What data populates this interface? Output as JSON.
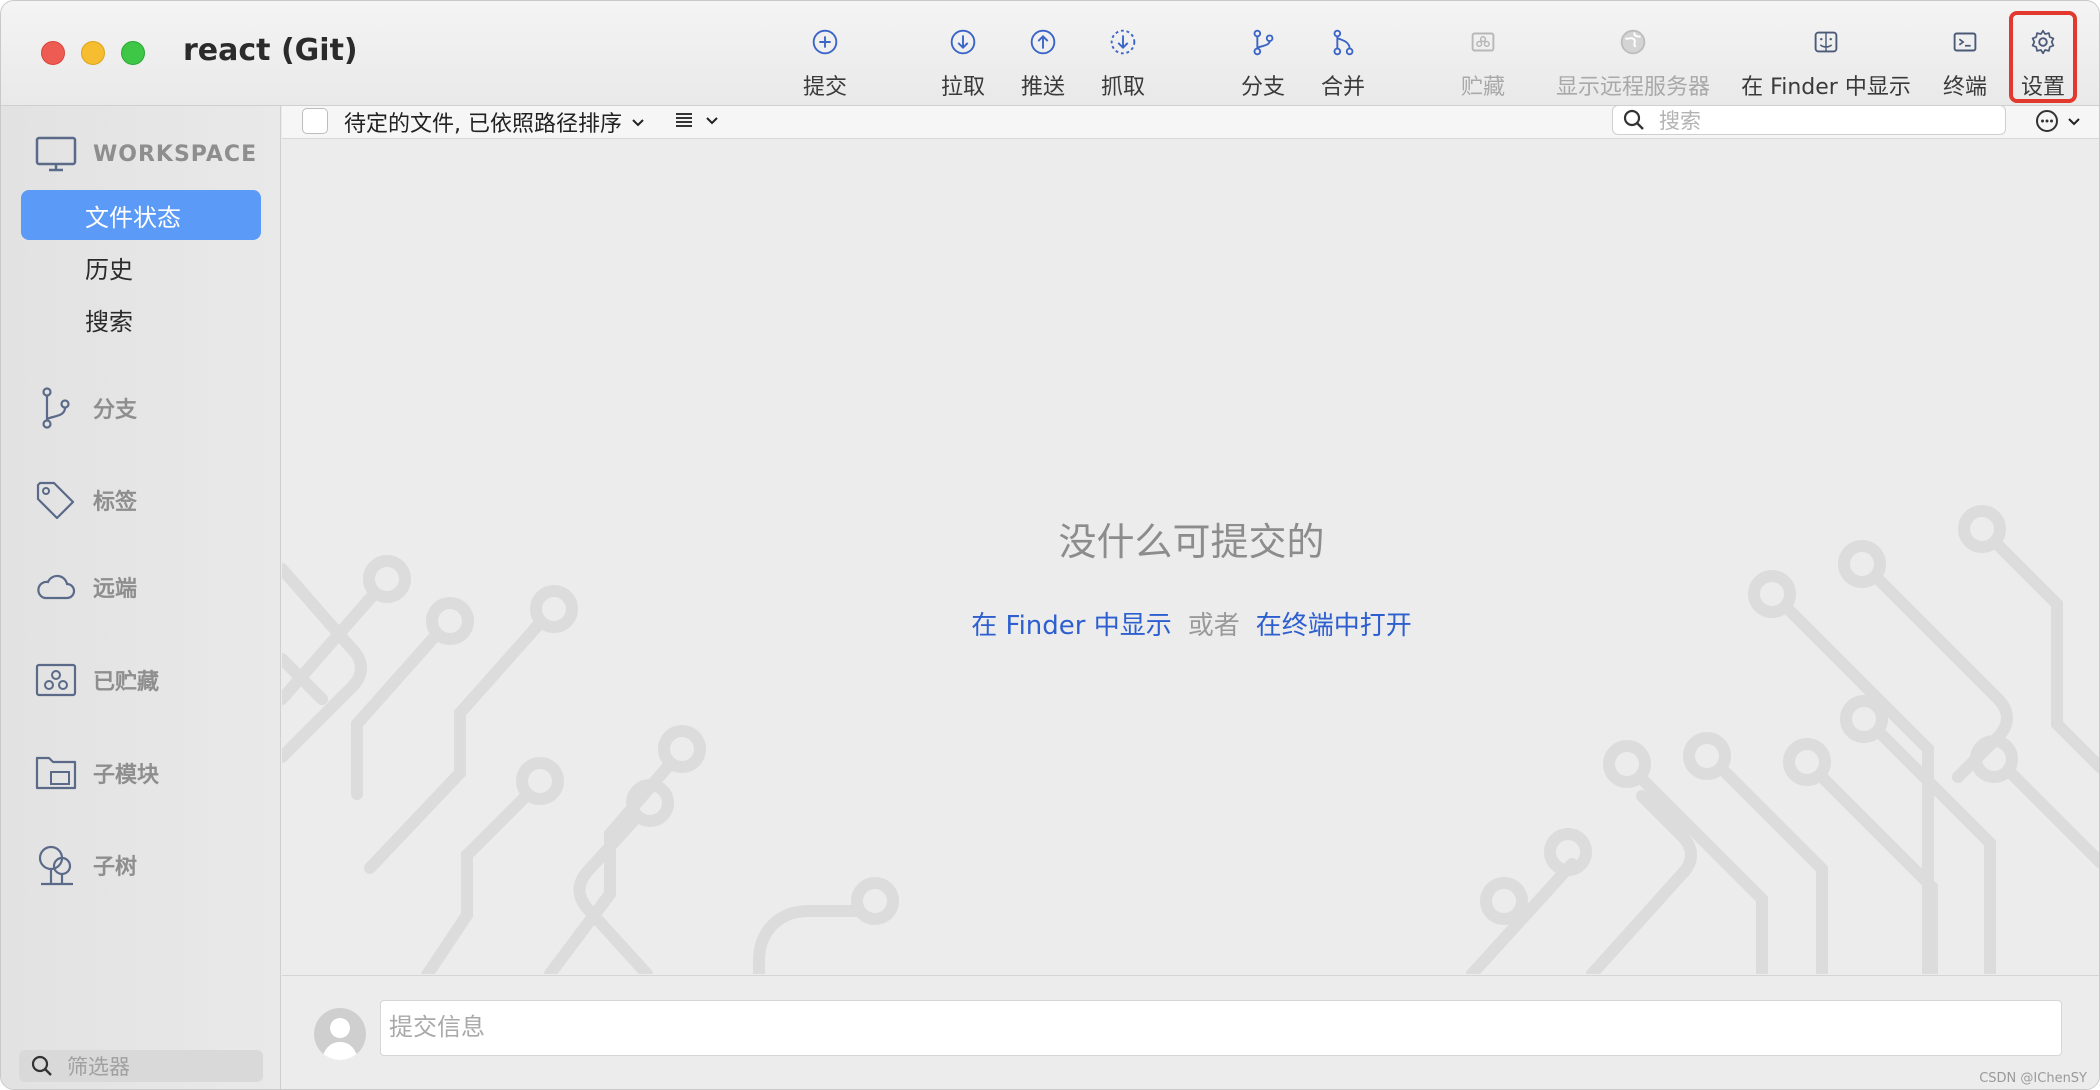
{
  "window": {
    "title": "react (Git)"
  },
  "toolbar": {
    "buttons": [
      {
        "label": "提交",
        "icon": "plus-circle-icon",
        "enabled": true
      },
      {
        "label": "拉取",
        "icon": "arrow-down-circle-icon",
        "enabled": true
      },
      {
        "label": "推送",
        "icon": "arrow-up-circle-icon",
        "enabled": true
      },
      {
        "label": "抓取",
        "icon": "fetch-dashed-circle-icon",
        "enabled": true
      },
      {
        "label": "分支",
        "icon": "branch-icon",
        "enabled": true
      },
      {
        "label": "合并",
        "icon": "merge-icon",
        "enabled": true
      },
      {
        "label": "贮藏",
        "icon": "stash-icon",
        "enabled": false
      },
      {
        "label": "显示远程服务器",
        "icon": "globe-icon",
        "enabled": false
      },
      {
        "label": "在 Finder 中显示",
        "icon": "finder-icon",
        "enabled": true
      },
      {
        "label": "终端",
        "icon": "terminal-icon",
        "enabled": true
      },
      {
        "label": "设置",
        "icon": "gear-icon",
        "enabled": true,
        "highlighted": true
      }
    ]
  },
  "sidebar": {
    "workspace_label": "WORKSPACE",
    "workspace_items": [
      {
        "label": "文件状态",
        "active": true
      },
      {
        "label": "历史",
        "active": false
      },
      {
        "label": "搜索",
        "active": false
      }
    ],
    "sections": [
      {
        "label": "分支",
        "icon": "branch-icon"
      },
      {
        "label": "标签",
        "icon": "tag-icon"
      },
      {
        "label": "远端",
        "icon": "cloud-icon"
      },
      {
        "label": "已贮藏",
        "icon": "stash-icon"
      },
      {
        "label": "子模块",
        "icon": "submodule-icon"
      },
      {
        "label": "子树",
        "icon": "subtree-icon"
      }
    ],
    "filter_placeholder": "筛选器"
  },
  "subbar": {
    "sort_label": "待定的文件, 已依照路径排序",
    "search_placeholder": "搜索"
  },
  "main": {
    "empty_title": "没什么可提交的",
    "link_finder": "在 Finder 中显示",
    "link_or": "或者",
    "link_terminal": "在终端中打开"
  },
  "commit": {
    "placeholder": "提交信息"
  },
  "watermark": "CSDN @IChenSY",
  "colors": {
    "accent": "#5b9af6",
    "link": "#2d5fd0",
    "highlight": "#e2382d"
  }
}
